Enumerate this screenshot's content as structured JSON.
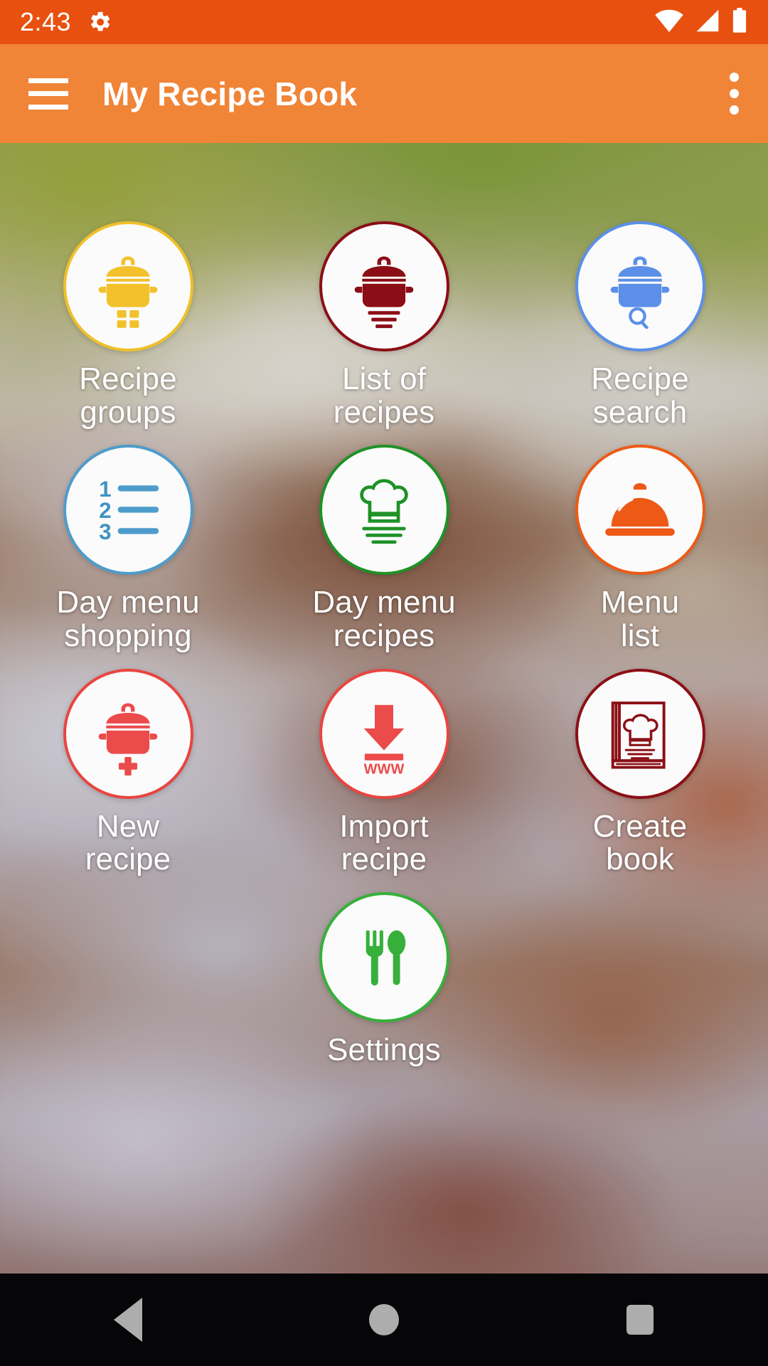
{
  "status_bar": {
    "time": "2:43",
    "icons": [
      "gear-icon",
      "wifi-icon",
      "cellular-signal-icon",
      "battery-icon"
    ],
    "background_color": "#E8500F"
  },
  "app_bar": {
    "menu_icon": "hamburger-menu-icon",
    "title": "My Recipe Book",
    "overflow_icon": "more-vertical-icon",
    "background_color": "#F08437"
  },
  "grid": {
    "rows": [
      {
        "tiles": [
          {
            "label": "Recipe\ngroups",
            "icon": "pot-with-grid-icon",
            "color": "#F0C028"
          },
          {
            "label": "List of\nrecipes",
            "icon": "pot-with-lines-icon",
            "color": "#8B0E16"
          },
          {
            "label": "Recipe\nsearch",
            "icon": "pot-with-search-icon",
            "color": "#5B8FE8"
          }
        ]
      },
      {
        "tiles": [
          {
            "label": "Day menu\nshopping",
            "icon": "numbered-list-icon",
            "color": "#4E9CCB"
          },
          {
            "label": "Day menu\nrecipes",
            "icon": "chef-hat-with-lines-icon",
            "color": "#1E9227"
          },
          {
            "label": "Menu\nlist",
            "icon": "cloche-serving-dome-icon",
            "color": "#EC5A16"
          }
        ]
      },
      {
        "tiles": [
          {
            "label": "New\nrecipe",
            "icon": "pot-with-plus-icon",
            "color": "#EC4B4B"
          },
          {
            "label": "Import\nrecipe",
            "icon": "download-www-icon",
            "color": "#EC4B4B",
            "sub_text": "WWW"
          },
          {
            "label": "Create\nbook",
            "icon": "recipe-book-icon",
            "color": "#8B1016"
          }
        ]
      },
      {
        "tiles": [
          {
            "label": "Settings",
            "icon": "fork-and-spoon-icon",
            "color": "#36B03A"
          }
        ]
      }
    ]
  },
  "nav_bar": {
    "back_icon": "back-triangle-icon",
    "home_icon": "home-circle-icon",
    "recents_icon": "recents-square-icon",
    "background_color": "#060608"
  }
}
